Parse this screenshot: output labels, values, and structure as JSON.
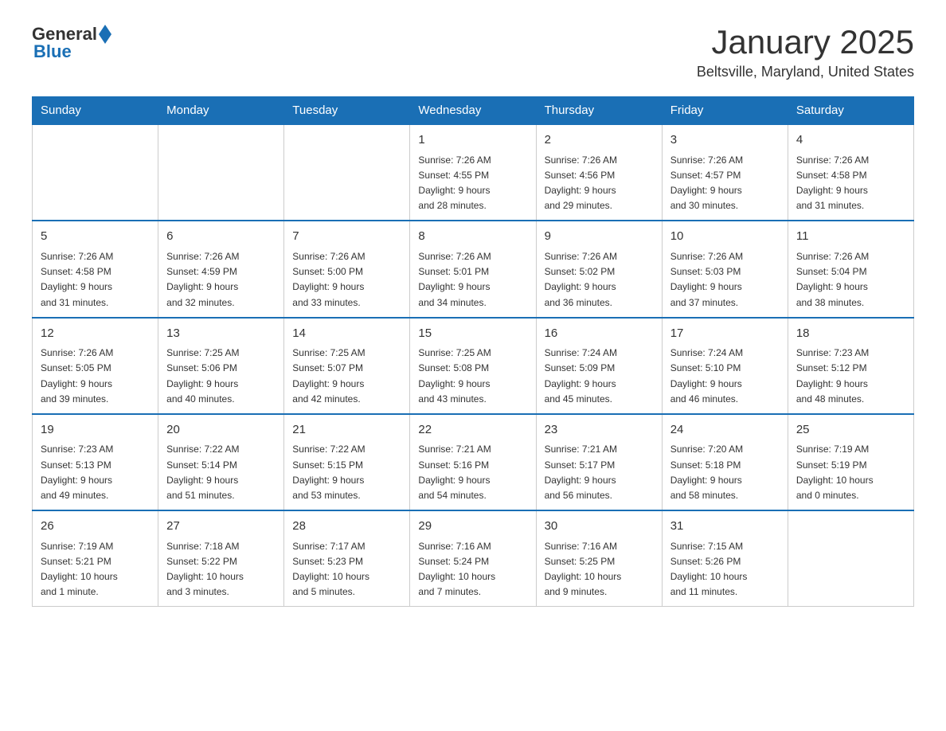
{
  "logo": {
    "general": "General",
    "blue": "Blue"
  },
  "title": "January 2025",
  "subtitle": "Beltsville, Maryland, United States",
  "headers": [
    "Sunday",
    "Monday",
    "Tuesday",
    "Wednesday",
    "Thursday",
    "Friday",
    "Saturday"
  ],
  "weeks": [
    [
      {
        "day": "",
        "info": ""
      },
      {
        "day": "",
        "info": ""
      },
      {
        "day": "",
        "info": ""
      },
      {
        "day": "1",
        "info": "Sunrise: 7:26 AM\nSunset: 4:55 PM\nDaylight: 9 hours\nand 28 minutes."
      },
      {
        "day": "2",
        "info": "Sunrise: 7:26 AM\nSunset: 4:56 PM\nDaylight: 9 hours\nand 29 minutes."
      },
      {
        "day": "3",
        "info": "Sunrise: 7:26 AM\nSunset: 4:57 PM\nDaylight: 9 hours\nand 30 minutes."
      },
      {
        "day": "4",
        "info": "Sunrise: 7:26 AM\nSunset: 4:58 PM\nDaylight: 9 hours\nand 31 minutes."
      }
    ],
    [
      {
        "day": "5",
        "info": "Sunrise: 7:26 AM\nSunset: 4:58 PM\nDaylight: 9 hours\nand 31 minutes."
      },
      {
        "day": "6",
        "info": "Sunrise: 7:26 AM\nSunset: 4:59 PM\nDaylight: 9 hours\nand 32 minutes."
      },
      {
        "day": "7",
        "info": "Sunrise: 7:26 AM\nSunset: 5:00 PM\nDaylight: 9 hours\nand 33 minutes."
      },
      {
        "day": "8",
        "info": "Sunrise: 7:26 AM\nSunset: 5:01 PM\nDaylight: 9 hours\nand 34 minutes."
      },
      {
        "day": "9",
        "info": "Sunrise: 7:26 AM\nSunset: 5:02 PM\nDaylight: 9 hours\nand 36 minutes."
      },
      {
        "day": "10",
        "info": "Sunrise: 7:26 AM\nSunset: 5:03 PM\nDaylight: 9 hours\nand 37 minutes."
      },
      {
        "day": "11",
        "info": "Sunrise: 7:26 AM\nSunset: 5:04 PM\nDaylight: 9 hours\nand 38 minutes."
      }
    ],
    [
      {
        "day": "12",
        "info": "Sunrise: 7:26 AM\nSunset: 5:05 PM\nDaylight: 9 hours\nand 39 minutes."
      },
      {
        "day": "13",
        "info": "Sunrise: 7:25 AM\nSunset: 5:06 PM\nDaylight: 9 hours\nand 40 minutes."
      },
      {
        "day": "14",
        "info": "Sunrise: 7:25 AM\nSunset: 5:07 PM\nDaylight: 9 hours\nand 42 minutes."
      },
      {
        "day": "15",
        "info": "Sunrise: 7:25 AM\nSunset: 5:08 PM\nDaylight: 9 hours\nand 43 minutes."
      },
      {
        "day": "16",
        "info": "Sunrise: 7:24 AM\nSunset: 5:09 PM\nDaylight: 9 hours\nand 45 minutes."
      },
      {
        "day": "17",
        "info": "Sunrise: 7:24 AM\nSunset: 5:10 PM\nDaylight: 9 hours\nand 46 minutes."
      },
      {
        "day": "18",
        "info": "Sunrise: 7:23 AM\nSunset: 5:12 PM\nDaylight: 9 hours\nand 48 minutes."
      }
    ],
    [
      {
        "day": "19",
        "info": "Sunrise: 7:23 AM\nSunset: 5:13 PM\nDaylight: 9 hours\nand 49 minutes."
      },
      {
        "day": "20",
        "info": "Sunrise: 7:22 AM\nSunset: 5:14 PM\nDaylight: 9 hours\nand 51 minutes."
      },
      {
        "day": "21",
        "info": "Sunrise: 7:22 AM\nSunset: 5:15 PM\nDaylight: 9 hours\nand 53 minutes."
      },
      {
        "day": "22",
        "info": "Sunrise: 7:21 AM\nSunset: 5:16 PM\nDaylight: 9 hours\nand 54 minutes."
      },
      {
        "day": "23",
        "info": "Sunrise: 7:21 AM\nSunset: 5:17 PM\nDaylight: 9 hours\nand 56 minutes."
      },
      {
        "day": "24",
        "info": "Sunrise: 7:20 AM\nSunset: 5:18 PM\nDaylight: 9 hours\nand 58 minutes."
      },
      {
        "day": "25",
        "info": "Sunrise: 7:19 AM\nSunset: 5:19 PM\nDaylight: 10 hours\nand 0 minutes."
      }
    ],
    [
      {
        "day": "26",
        "info": "Sunrise: 7:19 AM\nSunset: 5:21 PM\nDaylight: 10 hours\nand 1 minute."
      },
      {
        "day": "27",
        "info": "Sunrise: 7:18 AM\nSunset: 5:22 PM\nDaylight: 10 hours\nand 3 minutes."
      },
      {
        "day": "28",
        "info": "Sunrise: 7:17 AM\nSunset: 5:23 PM\nDaylight: 10 hours\nand 5 minutes."
      },
      {
        "day": "29",
        "info": "Sunrise: 7:16 AM\nSunset: 5:24 PM\nDaylight: 10 hours\nand 7 minutes."
      },
      {
        "day": "30",
        "info": "Sunrise: 7:16 AM\nSunset: 5:25 PM\nDaylight: 10 hours\nand 9 minutes."
      },
      {
        "day": "31",
        "info": "Sunrise: 7:15 AM\nSunset: 5:26 PM\nDaylight: 10 hours\nand 11 minutes."
      },
      {
        "day": "",
        "info": ""
      }
    ]
  ]
}
